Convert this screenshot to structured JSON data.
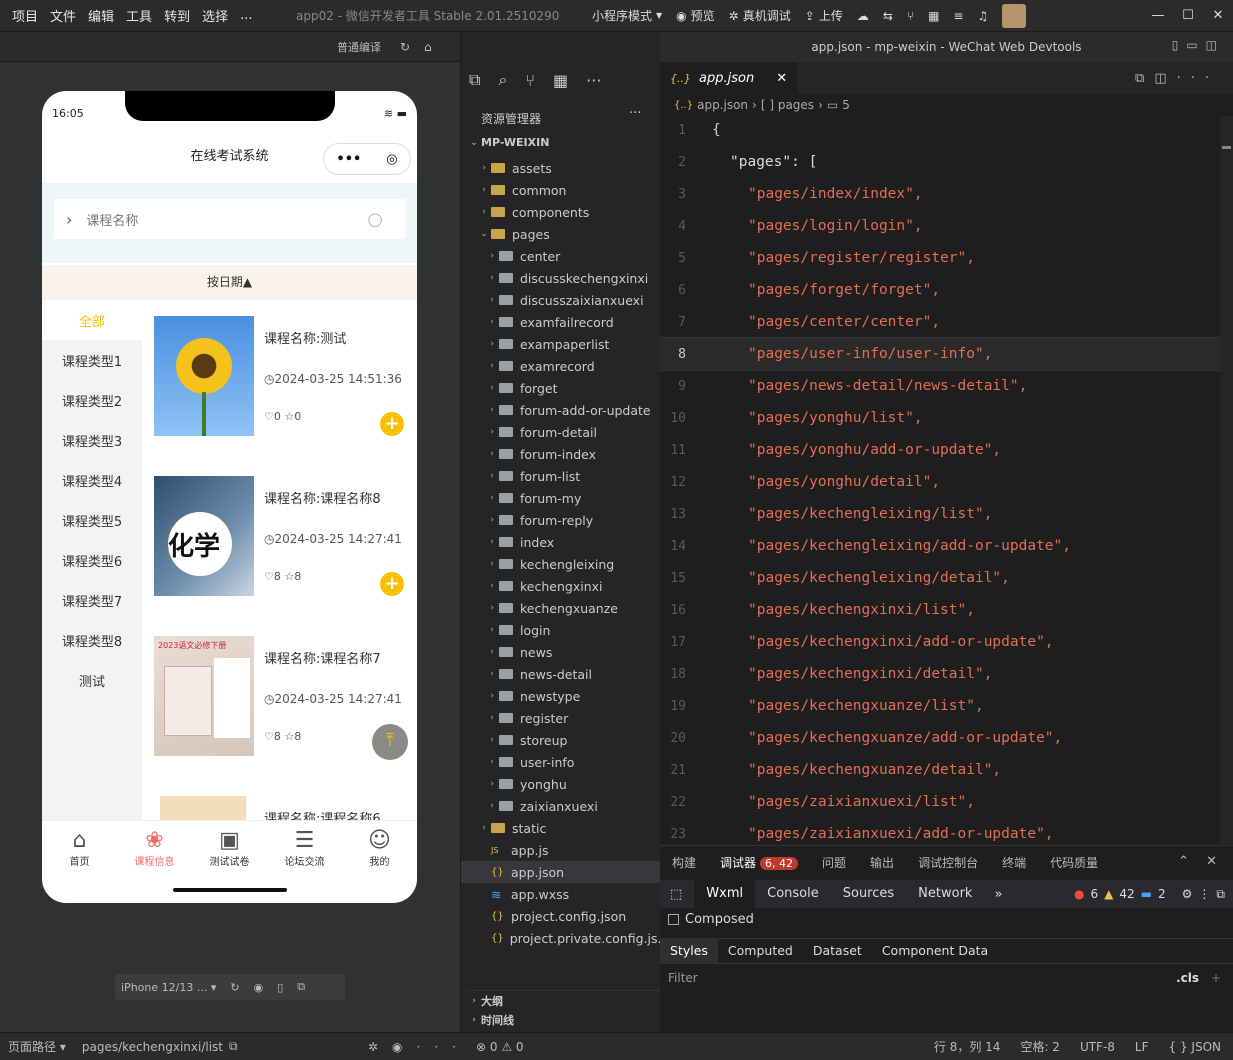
{
  "menu": [
    "项目",
    "文件",
    "编辑",
    "工具",
    "转到",
    "选择",
    "..."
  ],
  "window_title": "app02 - 微信开发者工具 Stable 2.01.2510290",
  "toolbar": {
    "mode": "小程序模式",
    "preview": "预览",
    "device_debug": "真机调试",
    "upload": "上传"
  },
  "sim_toolbar": {
    "compile": "普通编译"
  },
  "phone": {
    "time": "16:05",
    "title": "在线考试系统",
    "search_placeholder": "课程名称",
    "sort_label": "按日期",
    "categories": [
      "全部",
      "课程类型1",
      "课程类型2",
      "课程类型3",
      "课程类型4",
      "课程类型5",
      "课程类型6",
      "课程类型7",
      "课程类型8",
      "测试"
    ],
    "courses": [
      {
        "title": "课程名称:测试",
        "date": "2024-03-25 14:51:36",
        "likes": "0",
        "stars": "0"
      },
      {
        "title": "课程名称:课程名称8",
        "date": "2024-03-25 14:27:41",
        "likes": "8",
        "stars": "8"
      },
      {
        "title": "课程名称:课程名称7",
        "date": "2024-03-25 14:27:41",
        "likes": "8",
        "stars": "8"
      },
      {
        "title": "课程名称:课程名称6",
        "date": "",
        "likes": "",
        "stars": ""
      }
    ],
    "thumb_text_2": "化学",
    "thumb_text_3": "2023语文必修下册",
    "tabs": [
      "首页",
      "课程信息",
      "测试试卷",
      "论坛交流",
      "我的"
    ],
    "accent": "#f6c000",
    "tab_active": "#f06a6a"
  },
  "sim_bottom": {
    "device": "iPhone 12/13 ..."
  },
  "explorer": {
    "header": "资源管理器",
    "root": "MP-WEIXIN",
    "items": [
      {
        "label": "assets",
        "type": "folder",
        "depth": 0
      },
      {
        "label": "common",
        "type": "folder",
        "depth": 0
      },
      {
        "label": "components",
        "type": "folder",
        "depth": 0
      },
      {
        "label": "pages",
        "type": "folder-open",
        "depth": 0
      },
      {
        "label": "center",
        "type": "folder",
        "depth": 1
      },
      {
        "label": "discusskechengxinxi",
        "type": "folder",
        "depth": 1
      },
      {
        "label": "discusszaixianxuexi",
        "type": "folder",
        "depth": 1
      },
      {
        "label": "examfailrecord",
        "type": "folder",
        "depth": 1
      },
      {
        "label": "exampaperlist",
        "type": "folder",
        "depth": 1
      },
      {
        "label": "examrecord",
        "type": "folder",
        "depth": 1
      },
      {
        "label": "forget",
        "type": "folder",
        "depth": 1
      },
      {
        "label": "forum-add-or-update",
        "type": "folder",
        "depth": 1
      },
      {
        "label": "forum-detail",
        "type": "folder",
        "depth": 1
      },
      {
        "label": "forum-index",
        "type": "folder",
        "depth": 1
      },
      {
        "label": "forum-list",
        "type": "folder",
        "depth": 1
      },
      {
        "label": "forum-my",
        "type": "folder",
        "depth": 1
      },
      {
        "label": "forum-reply",
        "type": "folder",
        "depth": 1
      },
      {
        "label": "index",
        "type": "folder",
        "depth": 1
      },
      {
        "label": "kechengleixing",
        "type": "folder",
        "depth": 1
      },
      {
        "label": "kechengxinxi",
        "type": "folder",
        "depth": 1
      },
      {
        "label": "kechengxuanze",
        "type": "folder",
        "depth": 1
      },
      {
        "label": "login",
        "type": "folder",
        "depth": 1
      },
      {
        "label": "news",
        "type": "folder",
        "depth": 1
      },
      {
        "label": "news-detail",
        "type": "folder",
        "depth": 1
      },
      {
        "label": "newstype",
        "type": "folder",
        "depth": 1
      },
      {
        "label": "register",
        "type": "folder",
        "depth": 1
      },
      {
        "label": "storeup",
        "type": "folder",
        "depth": 1
      },
      {
        "label": "user-info",
        "type": "folder",
        "depth": 1
      },
      {
        "label": "yonghu",
        "type": "folder",
        "depth": 1
      },
      {
        "label": "zaixianxuexi",
        "type": "folder",
        "depth": 1
      },
      {
        "label": "static",
        "type": "folder",
        "depth": 0
      },
      {
        "label": "app.js",
        "type": "js",
        "depth": 0
      },
      {
        "label": "app.json",
        "type": "json",
        "depth": 0,
        "selected": true
      },
      {
        "label": "app.wxss",
        "type": "wxss",
        "depth": 0
      },
      {
        "label": "project.config.json",
        "type": "json",
        "depth": 0
      },
      {
        "label": "project.private.config.js...",
        "type": "json",
        "depth": 0
      }
    ],
    "outline": "大纲",
    "timeline": "时间线"
  },
  "editor": {
    "window_title": "app.json - mp-weixin - WeChat Web Devtools",
    "tab": "app.json",
    "breadcrumb": [
      "app.json",
      "[ ] pages",
      "5"
    ],
    "lines": [
      {
        "n": "1",
        "text": "{",
        "kind": "pun",
        "indent": 0
      },
      {
        "n": "2",
        "text": "\"pages\": [",
        "kind": "key",
        "indent": 1
      },
      {
        "n": "3",
        "text": "\"pages/index/index\",",
        "kind": "str",
        "indent": 2
      },
      {
        "n": "4",
        "text": "\"pages/login/login\",",
        "kind": "str",
        "indent": 2
      },
      {
        "n": "5",
        "text": "\"pages/register/register\",",
        "kind": "str",
        "indent": 2
      },
      {
        "n": "6",
        "text": "\"pages/forget/forget\",",
        "kind": "str",
        "indent": 2
      },
      {
        "n": "7",
        "text": "\"pages/center/center\",",
        "kind": "str",
        "indent": 2
      },
      {
        "n": "8",
        "text": "\"pages/user-info/user-info\",",
        "kind": "str",
        "indent": 2
      },
      {
        "n": "9",
        "text": "\"pages/news-detail/news-detail\",",
        "kind": "str",
        "indent": 2
      },
      {
        "n": "10",
        "text": "\"pages/yonghu/list\",",
        "kind": "str",
        "indent": 2
      },
      {
        "n": "11",
        "text": "\"pages/yonghu/add-or-update\",",
        "kind": "str",
        "indent": 2
      },
      {
        "n": "12",
        "text": "\"pages/yonghu/detail\",",
        "kind": "str",
        "indent": 2
      },
      {
        "n": "13",
        "text": "\"pages/kechengleixing/list\",",
        "kind": "str",
        "indent": 2
      },
      {
        "n": "14",
        "text": "\"pages/kechengleixing/add-or-update\",",
        "kind": "str",
        "indent": 2
      },
      {
        "n": "15",
        "text": "\"pages/kechengleixing/detail\",",
        "kind": "str",
        "indent": 2
      },
      {
        "n": "16",
        "text": "\"pages/kechengxinxi/list\",",
        "kind": "str",
        "indent": 2
      },
      {
        "n": "17",
        "text": "\"pages/kechengxinxi/add-or-update\",",
        "kind": "str",
        "indent": 2
      },
      {
        "n": "18",
        "text": "\"pages/kechengxinxi/detail\",",
        "kind": "str",
        "indent": 2
      },
      {
        "n": "19",
        "text": "\"pages/kechengxuanze/list\",",
        "kind": "str",
        "indent": 2
      },
      {
        "n": "20",
        "text": "\"pages/kechengxuanze/add-or-update\",",
        "kind": "str",
        "indent": 2
      },
      {
        "n": "21",
        "text": "\"pages/kechengxuanze/detail\",",
        "kind": "str",
        "indent": 2
      },
      {
        "n": "22",
        "text": "\"pages/zaixianxuexi/list\",",
        "kind": "str",
        "indent": 2
      },
      {
        "n": "23",
        "text": "\"pages/zaixianxuexi/add-or-update\",",
        "kind": "str",
        "indent": 2
      }
    ],
    "active_line": "8"
  },
  "debugger": {
    "tabs": [
      "构建",
      "调试器",
      "问题",
      "输出",
      "调试控制台",
      "终端",
      "代码质量"
    ],
    "badge": "6, 42",
    "subtabs": [
      "Wxml",
      "Console",
      "Sources",
      "Network"
    ],
    "errors": "6",
    "warnings": "42",
    "infos": "2",
    "composed": "Composed",
    "styles_tabs": [
      "Styles",
      "Computed",
      "Dataset",
      "Component Data"
    ],
    "filter_placeholder": "Filter",
    "cls": ".cls"
  },
  "status": {
    "page_path_label": "页面路径",
    "page_path": "pages/kechengxinxi/list",
    "errs": "0",
    "warns": "0",
    "cursor": "行 8，列 14",
    "spaces": "空格: 2",
    "encoding": "UTF-8",
    "eol": "LF",
    "lang": "JSON"
  }
}
